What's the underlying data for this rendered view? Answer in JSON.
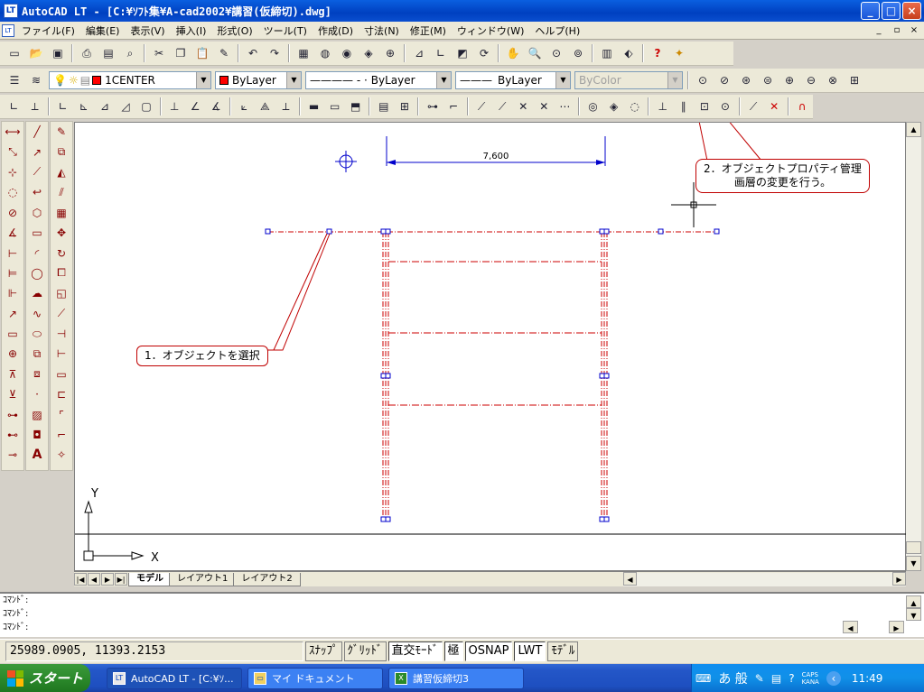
{
  "titlebar": {
    "app_icon": "LT",
    "title": "AutoCAD LT - [C:¥ｿﾌﾄ集¥A-cad2002¥講習(仮締切).dwg]",
    "buttons": [
      "_",
      "□",
      "×"
    ]
  },
  "menubar": {
    "app_icon": "LT",
    "items": [
      "ファイル(F)",
      "編集(E)",
      "表示(V)",
      "挿入(I)",
      "形式(O)",
      "ツール(T)",
      "作成(D)",
      "寸法(N)",
      "修正(M)",
      "ウィンドウ(W)",
      "ヘルプ(H)"
    ],
    "mdi_buttons": [
      "_",
      "▫",
      "×"
    ]
  },
  "standard_toolbar": {
    "icons": [
      "new-icon",
      "open-icon",
      "save-icon",
      "print-icon",
      "preview-icon",
      "find-icon",
      "cut-icon",
      "copy-icon",
      "paste-icon",
      "matchprop-icon",
      "undo-icon",
      "redo-icon",
      "designcenter-icon",
      "web-icon",
      "hyperlink-icon",
      "snap-icon",
      "ucs-icon",
      "distance-icon",
      "pan-icon",
      "zoom-realtime-icon",
      "zoom-window-icon",
      "zoom-previous-icon",
      "properties-icon",
      "layer-icon",
      "help-icon",
      "assist-icon"
    ]
  },
  "properties_toolbar": {
    "layer": "1CENTER",
    "color": "ByLayer",
    "linetype": "ByLayer",
    "linetype_prefix": "————  - ·",
    "lineweight": "ByLayer",
    "lineweight_prefix": "———",
    "plotstyle": "ByColor",
    "layer_color": "#ff0000"
  },
  "callouts": {
    "select": "1．オブジェクトを選択",
    "properties_line1": "2．オブジェクトプロパティ管理",
    "properties_line2": "画層の変更を行う。"
  },
  "drawing": {
    "dimension": "7,600",
    "ucs_y": "Y",
    "ucs_x": "X",
    "entity_color": "#cc0000",
    "grip_color": "#0000cc",
    "dim_color": "#0000cc"
  },
  "layout_tabs": [
    "モデル",
    "レイアウト1",
    "レイアウト2"
  ],
  "command_lines": [
    "ｺﾏﾝﾄﾞ:",
    "ｺﾏﾝﾄﾞ:",
    "ｺﾏﾝﾄﾞ:"
  ],
  "statusbar": {
    "coords": "25989.0905, 11393.2153",
    "buttons": [
      "ｽﾅｯﾌﾟ",
      "ｸﾞﾘｯﾄﾞ",
      "直交ﾓｰﾄﾞ",
      "極",
      "OSNAP",
      "LWT",
      "ﾓﾃﾞﾙ"
    ]
  },
  "taskbar": {
    "start": "スタート",
    "tasks": [
      "AutoCAD LT - [C:¥ｿ...",
      "マイ ドキュメント",
      "講習仮締切3"
    ],
    "ime": "あ 般",
    "caps": "CAPS",
    "kana": "KANA",
    "clock": "11:49"
  }
}
